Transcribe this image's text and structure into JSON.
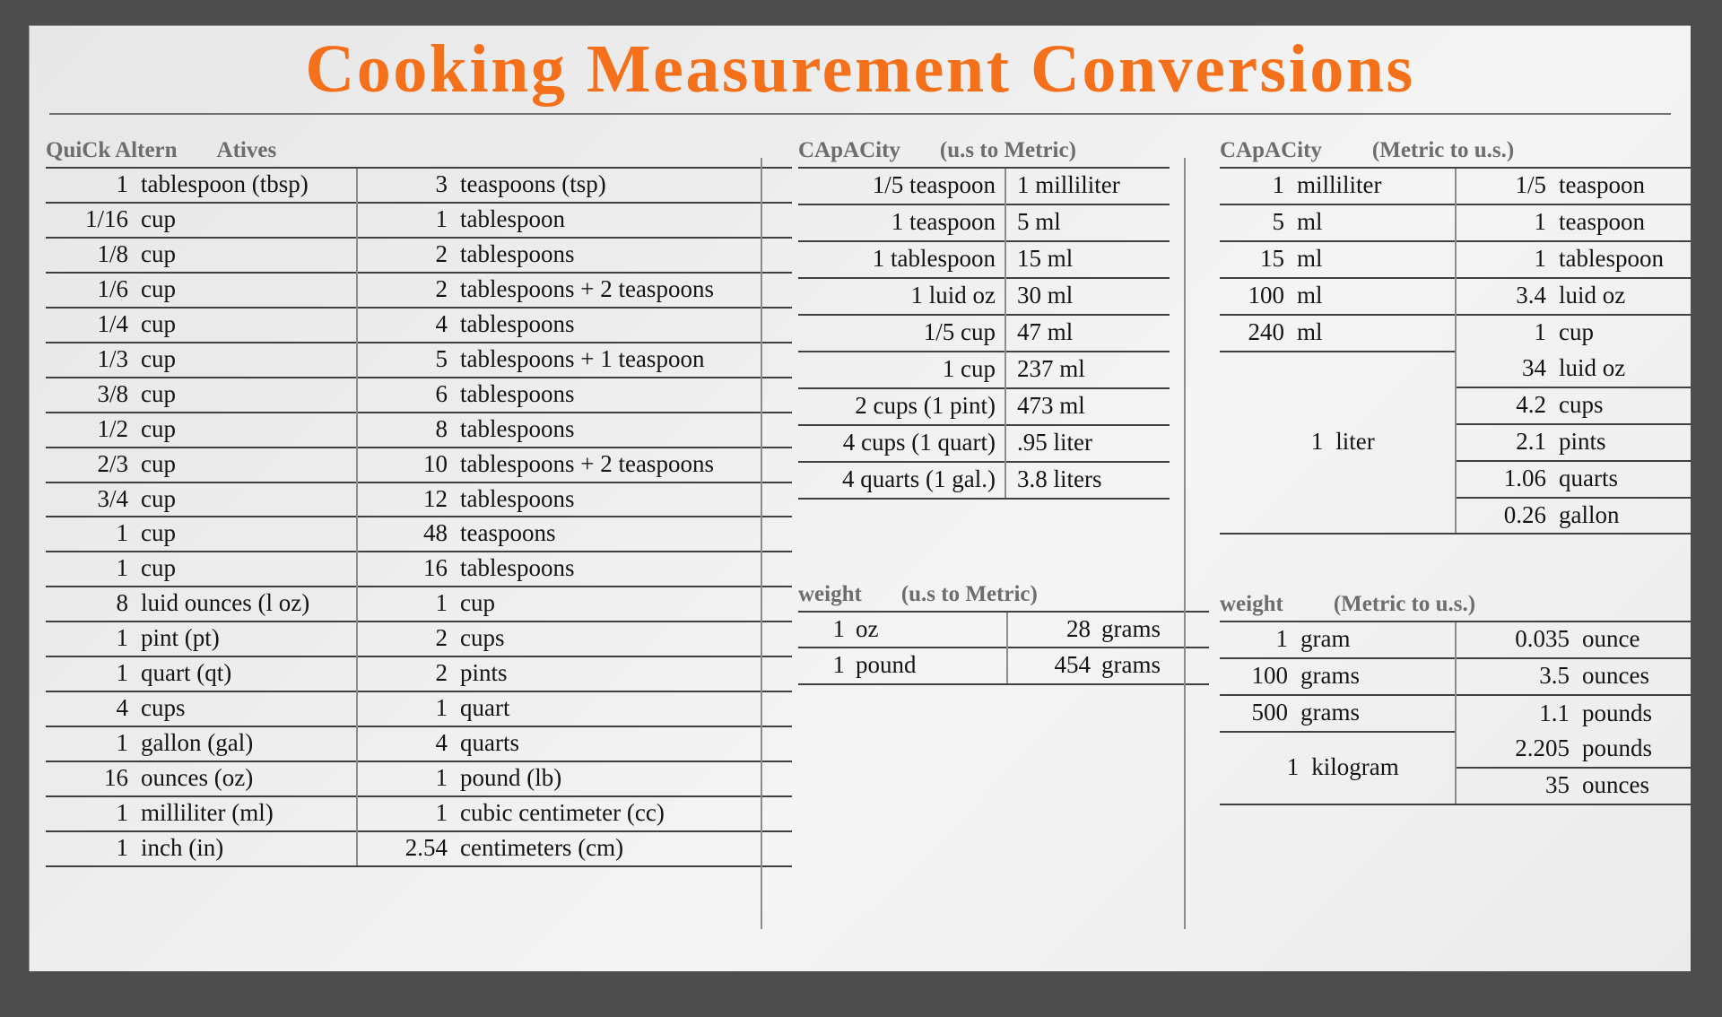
{
  "title": "Cooking Measurement Conversions",
  "sections": {
    "quick": {
      "heading_main": "QuiCk Altern",
      "heading_sub": "Atives",
      "rows": [
        {
          "n1": "1",
          "u1": "tablespoon (tbsp)",
          "n2": "3",
          "u2": "teaspoons (tsp)"
        },
        {
          "n1": "1/16",
          "u1": "cup",
          "n2": "1",
          "u2": "tablespoon"
        },
        {
          "n1": "1/8",
          "u1": "cup",
          "n2": "2",
          "u2": "tablespoons"
        },
        {
          "n1": "1/6",
          "u1": "cup",
          "n2": "2",
          "u2": "tablespoons + 2 teaspoons"
        },
        {
          "n1": "1/4",
          "u1": "cup",
          "n2": "4",
          "u2": "tablespoons"
        },
        {
          "n1": "1/3",
          "u1": "cup",
          "n2": "5",
          "u2": "tablespoons + 1 teaspoon"
        },
        {
          "n1": "3/8",
          "u1": "cup",
          "n2": "6",
          "u2": "tablespoons"
        },
        {
          "n1": "1/2",
          "u1": "cup",
          "n2": "8",
          "u2": "tablespoons"
        },
        {
          "n1": "2/3",
          "u1": "cup",
          "n2": "10",
          "u2": "tablespoons + 2 teaspoons"
        },
        {
          "n1": "3/4",
          "u1": "cup",
          "n2": "12",
          "u2": "tablespoons"
        },
        {
          "n1": "1",
          "u1": "cup",
          "n2": "48",
          "u2": "teaspoons"
        },
        {
          "n1": "1",
          "u1": "cup",
          "n2": "16",
          "u2": "tablespoons"
        },
        {
          "n1": "8",
          "u1": "luid ounces (l oz)",
          "n2": "1",
          "u2": "cup"
        },
        {
          "n1": "1",
          "u1": "pint (pt)",
          "n2": "2",
          "u2": "cups"
        },
        {
          "n1": "1",
          "u1": "quart (qt)",
          "n2": "2",
          "u2": "pints"
        },
        {
          "n1": "4",
          "u1": "cups",
          "n2": "1",
          "u2": "quart"
        },
        {
          "n1": "1",
          "u1": "gallon (gal)",
          "n2": "4",
          "u2": "quarts"
        },
        {
          "n1": "16",
          "u1": "ounces (oz)",
          "n2": "1",
          "u2": "pound (lb)"
        },
        {
          "n1": "1",
          "u1": "milliliter (ml)",
          "n2": "1",
          "u2": "cubic centimeter (cc)"
        },
        {
          "n1": "1",
          "u1": "inch (in)",
          "n2": "2.54",
          "u2": "centimeters (cm)"
        }
      ]
    },
    "capacity_us_to_metric": {
      "heading_main": "CApACity",
      "heading_sub": "(u.s to Metric)",
      "rows": [
        {
          "from": "1/5 teaspoon",
          "to": "1 milliliter"
        },
        {
          "from": "1 teaspoon",
          "to": "5 ml"
        },
        {
          "from": "1 tablespoon",
          "to": "15 ml"
        },
        {
          "from": "1 luid oz",
          "to": "30 ml"
        },
        {
          "from": "1/5 cup",
          "to": "47 ml"
        },
        {
          "from": "1 cup",
          "to": "237 ml"
        },
        {
          "from": "2 cups (1 pint)",
          "to": "473 ml"
        },
        {
          "from": "4 cups (1 quart)",
          "to": ".95 liter"
        },
        {
          "from": "4 quarts (1 gal.)",
          "to": "3.8 liters"
        }
      ]
    },
    "capacity_metric_to_us": {
      "heading_main": "CApACity",
      "heading_sub": "(Metric to u.s.)",
      "rows": [
        {
          "n1": "1",
          "u1": "milliliter",
          "n2": "1/5",
          "u2": "teaspoon"
        },
        {
          "n1": "5",
          "u1": "ml",
          "n2": "1",
          "u2": "teaspoon"
        },
        {
          "n1": "15",
          "u1": "ml",
          "n2": "1",
          "u2": "tablespoon"
        },
        {
          "n1": "100",
          "u1": "ml",
          "n2": "3.4",
          "u2": "luid oz"
        },
        {
          "n1": "240",
          "u1": "ml",
          "n2": "1",
          "u2": "cup"
        }
      ],
      "merged": {
        "n1": "1",
        "u1": "liter",
        "rows": [
          {
            "n2": "34",
            "u2": "luid oz"
          },
          {
            "n2": "4.2",
            "u2": "cups"
          },
          {
            "n2": "2.1",
            "u2": "pints"
          },
          {
            "n2": "1.06",
            "u2": "quarts"
          },
          {
            "n2": "0.26",
            "u2": "gallon"
          }
        ]
      }
    },
    "weight_us_to_metric": {
      "heading_main": "weight",
      "heading_sub": "(u.s to Metric)",
      "rows": [
        {
          "n1": "1",
          "u1": "oz",
          "n2": "28",
          "u2": "grams"
        },
        {
          "n1": "1",
          "u1": "pound",
          "n2": "454",
          "u2": "grams"
        }
      ]
    },
    "weight_metric_to_us": {
      "heading_main": "weight",
      "heading_sub": "(Metric to u.s.)",
      "rows": [
        {
          "n1": "1",
          "u1": "gram",
          "n2": "0.035",
          "u2": "ounce"
        },
        {
          "n1": "100",
          "u1": "grams",
          "n2": "3.5",
          "u2": "ounces"
        },
        {
          "n1": "500",
          "u1": "grams",
          "n2": "1.1",
          "u2": "pounds"
        }
      ],
      "merged": {
        "n1": "1",
        "u1": "kilogram",
        "rows": [
          {
            "n2": "2.205",
            "u2": "pounds"
          },
          {
            "n2": "35",
            "u2": "ounces"
          }
        ]
      }
    }
  },
  "colors": {
    "title": "#f4701a",
    "frame": "#4d4d4d",
    "page": "#ececec",
    "heading_text": "#6d6d6d",
    "rule": "#3f3f3f"
  }
}
